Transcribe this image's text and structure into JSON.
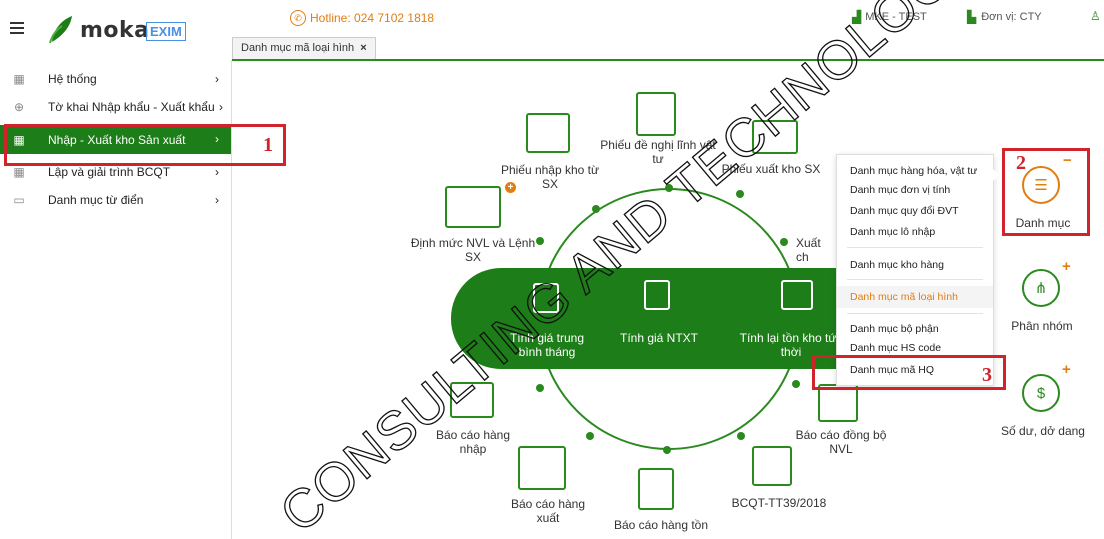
{
  "header": {
    "logo_text": "moka",
    "logo_badge": "EXIM",
    "hotline": "Hotline: 024 7102 1818",
    "account": "MKE - TEST",
    "unit": "Đơn vị: CTY"
  },
  "tabs": [
    {
      "label": "Danh mục mã loại hình",
      "close": "×"
    }
  ],
  "sidebar": {
    "items": [
      {
        "label": "Hệ thống",
        "chev": "›"
      },
      {
        "label": "Tờ khai Nhập khẩu - Xuất khẩu",
        "chev": "›"
      },
      {
        "label": "Nhập - Xuất kho Sản xuất",
        "chev": "›"
      },
      {
        "label": "Lập và giải trình BCQT",
        "chev": "›"
      },
      {
        "label": "Danh mục từ điển",
        "chev": "›"
      }
    ]
  },
  "annotations": {
    "n1": "1",
    "n2": "2",
    "n3": "3"
  },
  "diagram": {
    "band": [
      {
        "label": "Tính giá trung bình tháng"
      },
      {
        "label": "Tính giá NTXT"
      },
      {
        "label": "Tính lại tồn kho tức thời"
      }
    ],
    "nodes": {
      "phieu_nhap": "Phiếu nhập kho từ SX",
      "phieu_de_nghi": "Phiếu đề nghị lĩnh vật tư",
      "phieu_xuat": "Phiếu xuất kho SX",
      "xuat_ch": "Xuất ch",
      "dinh_muc": "Định mức NVL và Lệnh SX",
      "bc_nhap": "Báo cáo hàng nhập",
      "bc_dong_bo": "Báo cáo đồng bộ NVL",
      "bc_xuat": "Báo cáo hàng xuất",
      "bc_ton": "Báo cáo hàng tồn",
      "bcqt": "BCQT-TT39/2018"
    }
  },
  "dropdown": {
    "items": [
      "Danh mục hàng hóa, vật tư",
      "Danh mục đơn vị tính",
      "Danh mục quy đổi ĐVT",
      "Danh mục lô nhập",
      "Danh mục kho hàng",
      "Danh mục mã loại hình",
      "Danh mục bộ phận",
      "Danh mục HS code",
      "Danh mục mã HQ"
    ]
  },
  "right_panel": {
    "danh_muc": "Danh mục",
    "phan_nhom": "Phân nhóm",
    "so_du": "Số dư, dở dang",
    "minus": "−",
    "plus": "+"
  },
  "watermark": {
    "text": "CONSULTING AND TECHNOLOGY .JSC"
  },
  "colors": {
    "green": "#1d7d18",
    "orange": "#e27d12",
    "red_mark": "#d0232a"
  }
}
